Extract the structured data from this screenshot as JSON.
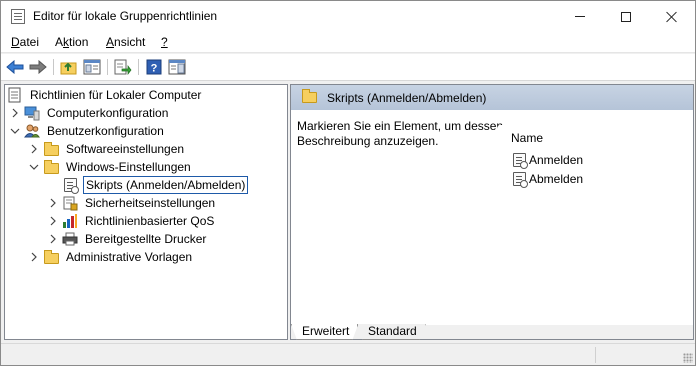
{
  "window": {
    "title": "Editor für lokale Gruppenrichtlinien"
  },
  "menu": {
    "items": [
      {
        "label": "Datei",
        "accel": "D",
        "rest": "atei"
      },
      {
        "label": "Aktion",
        "accel": "k",
        "pre": "A",
        "rest": "tion"
      },
      {
        "label": "Ansicht",
        "accel": "A",
        "rest": "nsicht"
      },
      {
        "label": "?",
        "accel": "?",
        "rest": ""
      }
    ]
  },
  "toolbar": {
    "buttons": [
      {
        "icon": "back-arrow-icon"
      },
      {
        "icon": "forward-arrow-icon"
      },
      {
        "icon": "up-folder-icon"
      },
      {
        "icon": "show-hide-tree-icon"
      },
      {
        "icon": "export-list-icon"
      },
      {
        "icon": "help-icon"
      },
      {
        "icon": "properties-pane-icon"
      }
    ]
  },
  "tree": {
    "root": "Richtlinien für Lokaler Computer",
    "nodes": [
      {
        "label": "Computerkonfiguration",
        "level": 1,
        "expanded": false
      },
      {
        "label": "Benutzerkonfiguration",
        "level": 1,
        "expanded": true
      },
      {
        "label": "Softwareeinstellungen",
        "level": 2,
        "expanded": false
      },
      {
        "label": "Windows-Einstellungen",
        "level": 2,
        "expanded": true
      },
      {
        "label": "Skripts (Anmelden/Abmelden)",
        "level": 3,
        "selected": true
      },
      {
        "label": "Sicherheitseinstellungen",
        "level": 3,
        "expanded": false
      },
      {
        "label": "Richtlinienbasierter QoS",
        "level": 3,
        "expanded": false
      },
      {
        "label": "Bereitgestellte Drucker",
        "level": 3,
        "expanded": false
      },
      {
        "label": "Administrative Vorlagen",
        "level": 2,
        "expanded": false
      }
    ]
  },
  "details": {
    "header": "Skripts (Anmelden/Abmelden)",
    "description": "Markieren Sie ein Element, um dessen Beschreibung anzuzeigen.",
    "column_name": "Name",
    "items": [
      "Anmelden",
      "Abmelden"
    ],
    "tabs": [
      {
        "label": "Erweitert",
        "active": true
      },
      {
        "label": "Standard",
        "active": false
      }
    ]
  },
  "colors": {
    "accent": "#1e5aa8",
    "header_bg": "#c0cfe1",
    "folder": "#f6cf5f"
  }
}
